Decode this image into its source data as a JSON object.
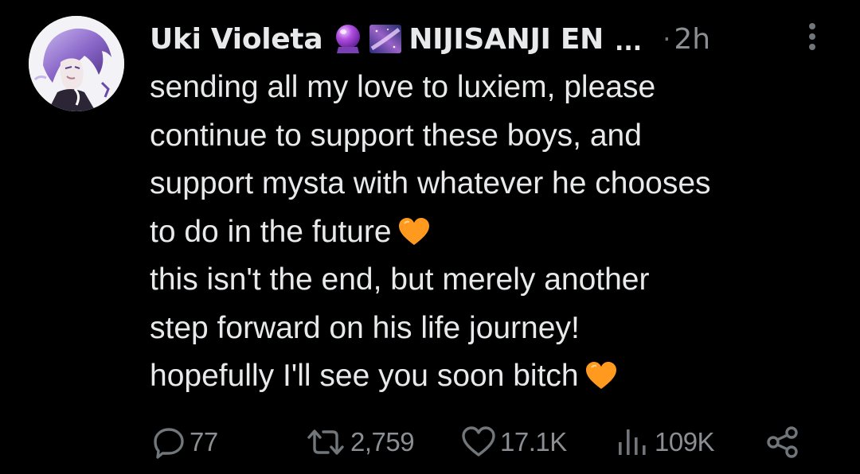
{
  "tweet": {
    "author": {
      "display_name": "Uki Violeta",
      "emojis": [
        "crystal-ball-emoji",
        "milky-way-emoji"
      ],
      "affiliation": "NIJISANJI EN",
      "truncation": "...",
      "avatar": "avatar-purple-hair-illustration"
    },
    "separator": "·",
    "time": "2h",
    "more_icon": "more-vertical-icon",
    "body": {
      "lines": [
        "sending all my love to luxiem, please",
        "continue to support these boys, and",
        "support mysta with whatever he chooses",
        "to do in the future",
        "this isn't the end, but merely another",
        "step forward on his life journey!",
        "hopefully I'll see you soon bitch"
      ],
      "emoji": "orange-heart-emoji"
    },
    "actions": {
      "reply": {
        "icon": "reply-icon",
        "count": "77"
      },
      "retweet": {
        "icon": "retweet-icon",
        "count": "2,759"
      },
      "like": {
        "icon": "heart-icon",
        "count": "17.1K"
      },
      "views": {
        "icon": "views-icon",
        "count": "109K"
      },
      "share": {
        "icon": "share-icon"
      }
    }
  },
  "colors": {
    "background": "#000000",
    "text_primary": "#e7e9ea",
    "text_secondary": "#71767b",
    "heart_orange": "#ff9a1f"
  }
}
